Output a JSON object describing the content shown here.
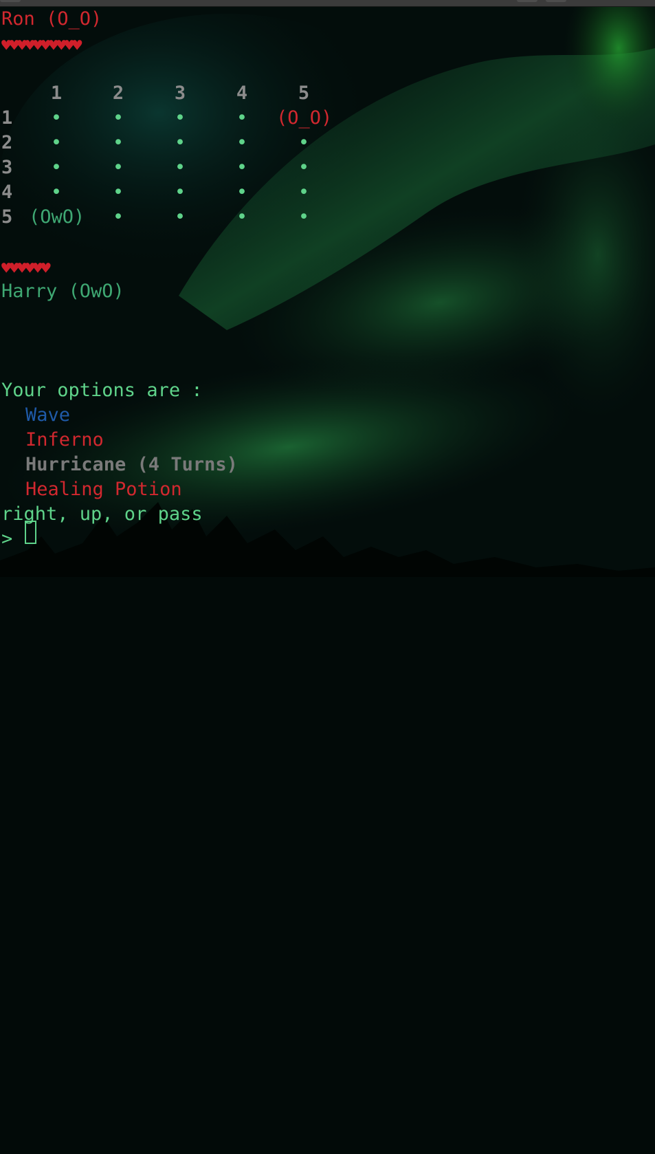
{
  "window": {
    "background_accent": "#1e7a3e"
  },
  "enemy": {
    "name": "Ron (O_O)",
    "hearts": "♥♥♥♥♥♥♥♥♥♥",
    "color": "#d2282f"
  },
  "board": {
    "columns": [
      "1",
      "2",
      "3",
      "4",
      "5"
    ],
    "rows": [
      "1",
      "2",
      "3",
      "4",
      "5"
    ],
    "cells": [
      [
        "•",
        "•",
        "•",
        "•",
        "(O_O)"
      ],
      [
        "•",
        "•",
        "•",
        "•",
        "•"
      ],
      [
        "•",
        "•",
        "•",
        "•",
        "•"
      ],
      [
        "•",
        "•",
        "•",
        "•",
        "•"
      ],
      [
        "(OwO)",
        "•",
        "•",
        "•",
        "•"
      ]
    ]
  },
  "player": {
    "name": "Harry (OwO)",
    "hearts": "♥♥♥♥♥♥",
    "color": "#3fa873"
  },
  "options": {
    "header": "Your options are :",
    "items": [
      {
        "label": "Wave",
        "color": "#1f5aa8"
      },
      {
        "label": "Inferno",
        "color": "#d2282f"
      },
      {
        "label": "Hurricane (4 Turns)",
        "color": "#7a7a7a"
      },
      {
        "label": "Healing Potion",
        "color": "#d2282f"
      }
    ]
  },
  "moves": {
    "text": "right, up, or pass"
  },
  "prompt": {
    "symbol": ">"
  }
}
